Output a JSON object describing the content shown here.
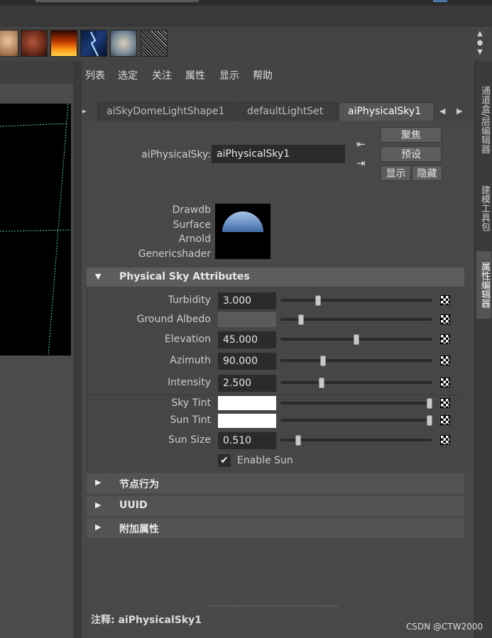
{
  "menu": [
    "列表",
    "选定",
    "关注",
    "属性",
    "显示",
    "帮助"
  ],
  "tabs": [
    "aiSkyDomeLightShape1",
    "defaultLightSet",
    "aiPhysicalSky1"
  ],
  "node": {
    "label": "aiPhysicalSky:",
    "value": "aiPhysicalSky1"
  },
  "buttons": {
    "focus": "聚焦",
    "presets": "预设",
    "show": "显示",
    "hide": "隐藏"
  },
  "shading_groups": [
    "Drawdb",
    "Surface",
    "Arnold",
    "Genericshader"
  ],
  "sections": {
    "physical_sky": "Physical Sky Attributes",
    "node_behavior": "节点行为",
    "uuid": "UUID",
    "extra": "附加属性"
  },
  "attributes": {
    "turbidity": {
      "label": "Turbidity",
      "value": "3.000",
      "slider": 0.24
    },
    "ground_albedo": {
      "label": "Ground Albedo",
      "value": "",
      "slider": 0.12
    },
    "elevation": {
      "label": "Elevation",
      "value": "45.000",
      "slider": 0.5
    },
    "azimuth": {
      "label": "Azimuth",
      "value": "90.000",
      "slider": 0.27
    },
    "intensity": {
      "label": "Intensity",
      "value": "2.500",
      "slider": 0.26
    },
    "sky_tint": {
      "label": "Sky Tint",
      "color": "#ffffff",
      "slider": 1.0
    },
    "sun_tint": {
      "label": "Sun Tint",
      "color": "#ffffff",
      "slider": 1.0
    },
    "sun_size": {
      "label": "Sun Size",
      "value": "0.510",
      "slider": 0.1
    }
  },
  "enable_sun": {
    "label": "Enable Sun",
    "checked": true
  },
  "notes": "注释:  aiPhysicalSky1",
  "right_tabs": [
    "通道盒/层编辑器",
    "建模工具包",
    "属性编辑器"
  ],
  "watermark": "CSDN @CTW2000",
  "colors": {
    "panel": "#484848",
    "section_header": "#5d5d5d",
    "field": "#2b2b2b"
  }
}
